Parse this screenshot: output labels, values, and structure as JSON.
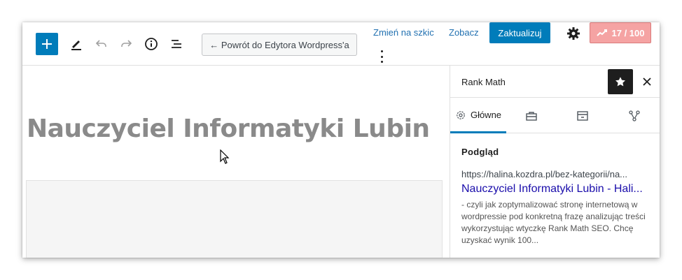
{
  "toolbar": {
    "add_icon": "plus-icon",
    "tools": [
      "pencil-icon",
      "undo-icon",
      "redo-icon",
      "info-icon",
      "list-view-icon"
    ],
    "back_label": "← Powrót do Edytora Wordpress'a",
    "draft_label": "Zmień na szkic",
    "view_label": "Zobacz",
    "update_label": "Zaktualizuj",
    "score_label": "17 / 100",
    "accent_color": "#007cba",
    "score_color": "#f5a3a3"
  },
  "editor": {
    "post_title": "Nauczyciel Informatyki Lubin"
  },
  "sidebar": {
    "title": "Rank Math",
    "tabs": [
      {
        "label": "Główne",
        "icon": "gear-icon",
        "active": true
      },
      {
        "label": "",
        "icon": "toolbox-icon",
        "active": false
      },
      {
        "label": "",
        "icon": "archive-icon",
        "active": false
      },
      {
        "label": "",
        "icon": "share-nodes-icon",
        "active": false
      }
    ],
    "preview": {
      "heading": "Podgląd",
      "url": "https://halina.kozdra.pl/bez-kategorii/na...",
      "title": "Nauczyciel Informatyki Lubin - Hali...",
      "description": "- czyli jak zoptymalizować stronę internetową w wordpressie pod konkretną frazę analizując treści wykorzystując wtyczkę Rank Math SEO. Chcę uzyskać wynik 100..."
    }
  }
}
